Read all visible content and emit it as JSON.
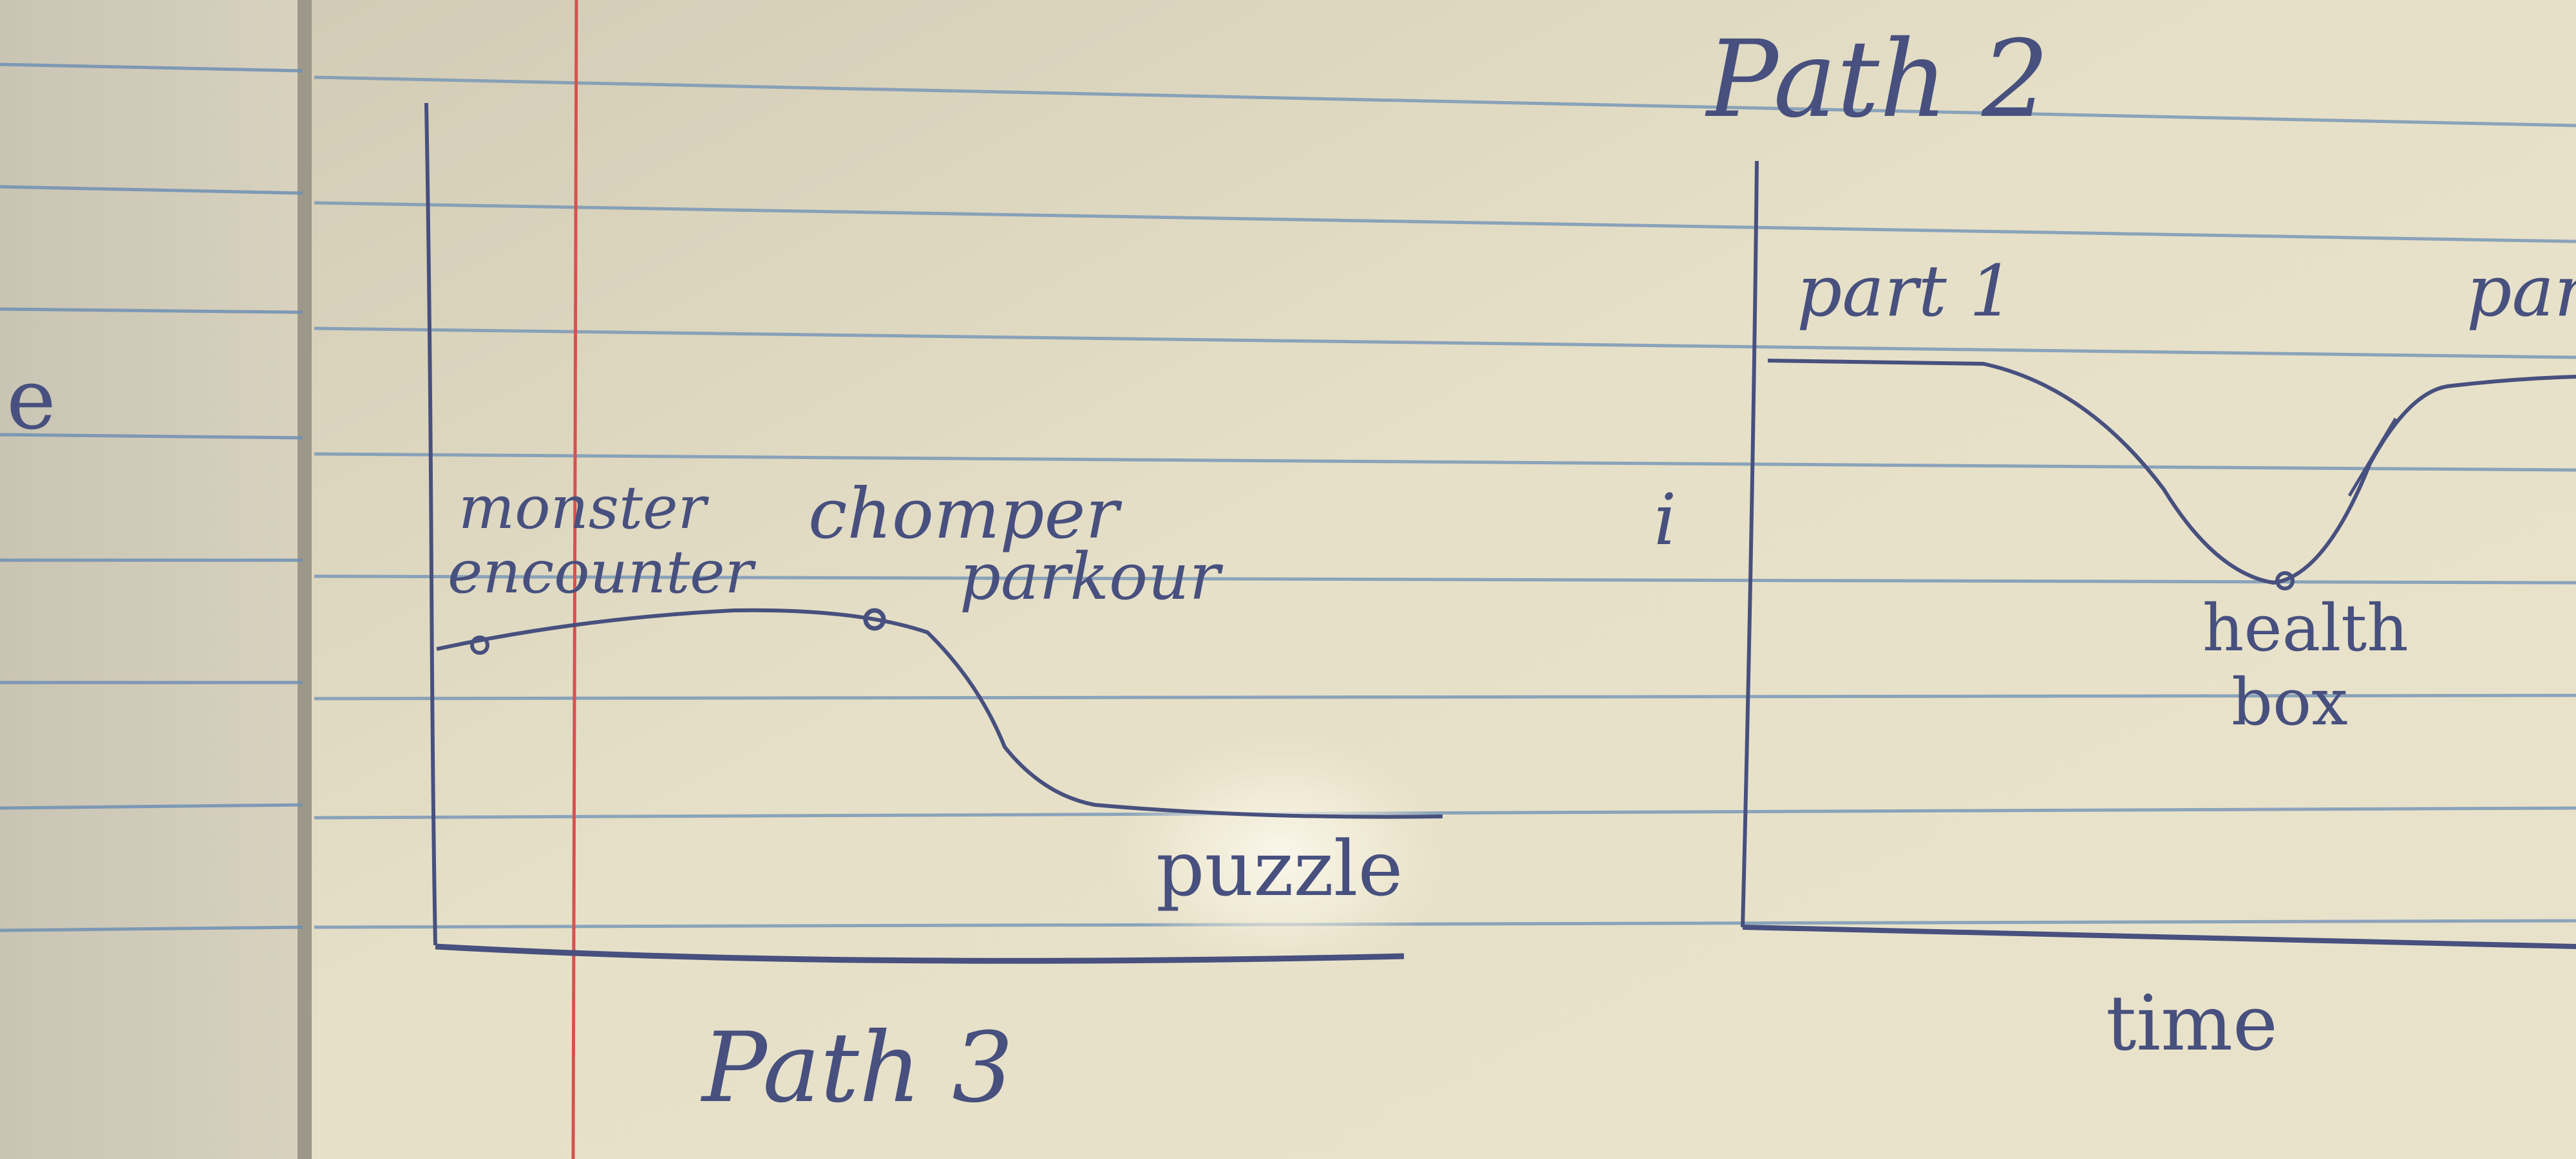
{
  "colors": {
    "paper": "#e9e3cc",
    "paper_shadow": "#b9b4a2",
    "rule_line": "#6e8fb3",
    "margin_line": "#d4524f",
    "ink": "#47507e",
    "highlight": "#fbf8ee"
  },
  "left_page": {
    "fragment": "e"
  },
  "path3_graph": {
    "labels": {
      "monster": "monster",
      "encounter": "encounter",
      "chomper": "chomper",
      "parkour": "parkour",
      "puzzle": "puzzle",
      "title": "Path 3"
    }
  },
  "path2_graph": {
    "labels": {
      "title": "Path 2",
      "part1": "part 1",
      "part_cut": "par",
      "health": "health",
      "box": "box",
      "axis_x": "time",
      "stray_mark": "i"
    }
  }
}
